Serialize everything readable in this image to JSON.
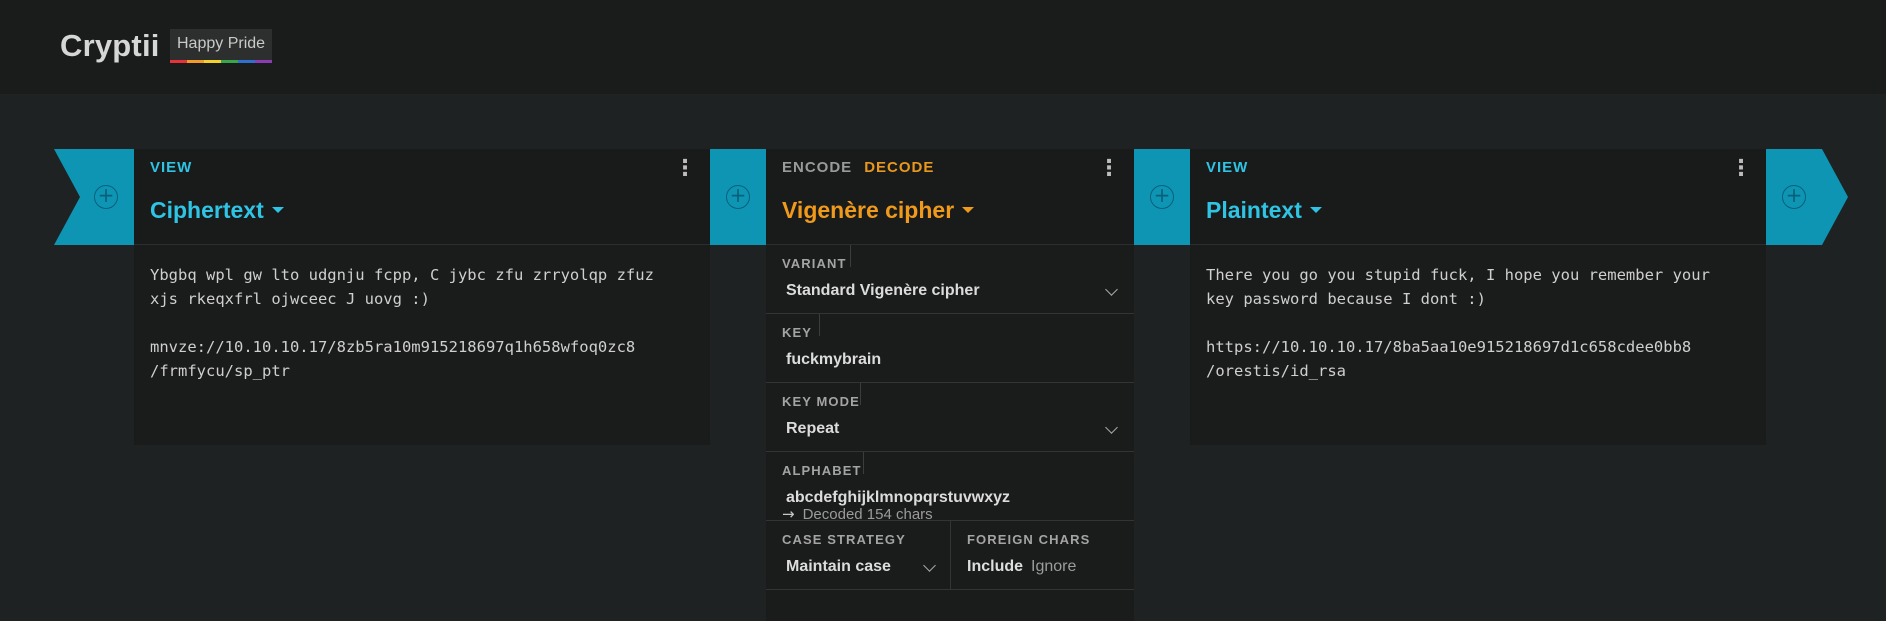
{
  "header": {
    "brand": "Cryptii",
    "badge": "Happy Pride"
  },
  "panels": {
    "ciphertext": {
      "tag": "VIEW",
      "title": "Ciphertext",
      "content": "Ybgbq wpl gw lto udgnju fcpp, C jybc zfu zrryolqp zfuz\nxjs rkeqxfrl ojwceec J uovg :)\n\nmnvze://10.10.10.17/8zb5ra10m915218697q1h658wfoq0zc8\n/frmfycu/sp_ptr"
    },
    "cipher": {
      "tag_encode": "ENCODE",
      "tag_decode": "DECODE",
      "title": "Vigenère cipher",
      "variant_label": "VARIANT",
      "variant_value": "Standard Vigenère cipher",
      "key_label": "KEY",
      "key_value": "fuckmybrain",
      "key_mode_label": "KEY MODE",
      "key_mode_value": "Repeat",
      "alphabet_label": "ALPHABET",
      "alphabet_value": "abcdefghijklmnopqrstuvwxyz",
      "case_label": "CASE STRATEGY",
      "case_value": "Maintain case",
      "foreign_label": "FOREIGN CHARS",
      "foreign_include": "Include",
      "foreign_ignore": "Ignore",
      "status": "Decoded 154 chars"
    },
    "plaintext": {
      "tag": "VIEW",
      "title": "Plaintext",
      "content": "There you go you stupid fuck, I hope you remember your\nkey password because I dont :)\n\nhttps://10.10.10.17/8ba5aa10e915218697d1c658cdee0bb8\n/orestis/id_rsa"
    }
  },
  "icons": {
    "add": "plus-circle-icon",
    "menu": "more-vertical-icon",
    "dropdown": "chevron-down-icon",
    "status_arrow": "arrow-right-icon"
  },
  "colors": {
    "view_accent": "#2fc4e4",
    "encoder_accent": "#f09a1c",
    "add_bar": "#0e95b4"
  }
}
